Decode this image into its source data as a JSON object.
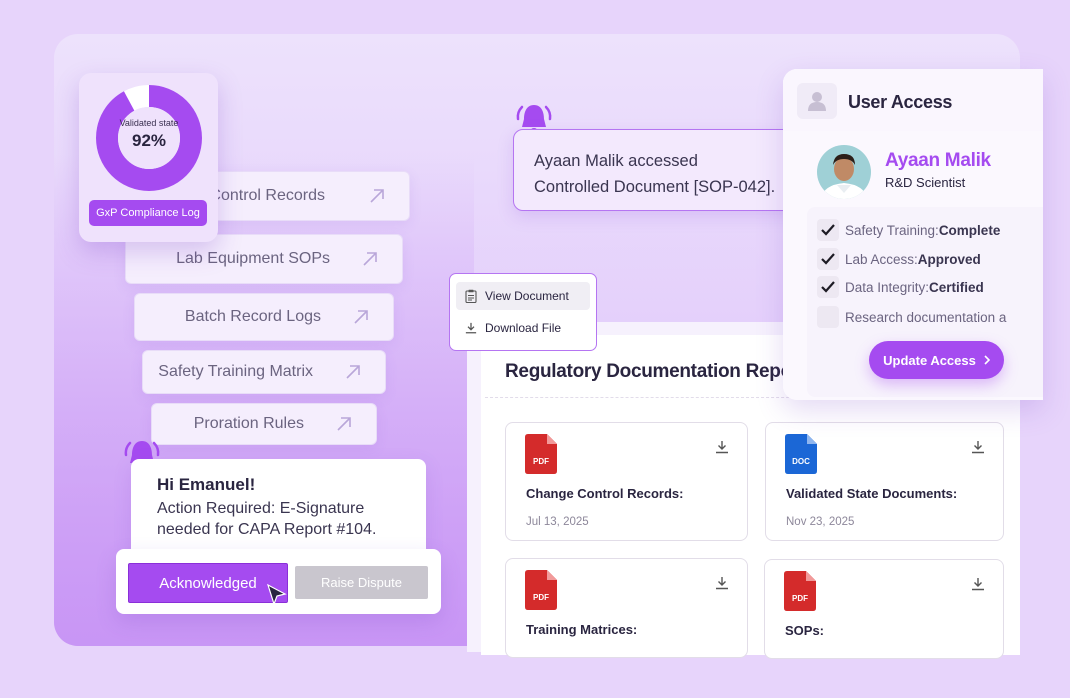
{
  "compliance": {
    "donut_label": "Validated state",
    "donut_value": "92%",
    "donut_fraction": 0.92,
    "log_button": "GxP Compliance Log"
  },
  "nav_items": [
    {
      "label": "e Control Records"
    },
    {
      "label": "Lab Equipment SOPs"
    },
    {
      "label": "Batch Record Logs"
    },
    {
      "label": "Safety Training Matrix"
    },
    {
      "label": "Proration Rules"
    }
  ],
  "notification": {
    "line1": "Ayaan Malik accessed",
    "line2": "Controlled Document [SOP-042]."
  },
  "context_menu": {
    "view": "View Document",
    "download": "Download File"
  },
  "report": {
    "title": "Regulatory Documentation Repo",
    "docs": [
      {
        "type": "PDF",
        "title": "Change Control Records:",
        "date": "Jul 13, 2025"
      },
      {
        "type": "DOC",
        "title": "Validated State Documents:",
        "date": "Nov 23, 2025"
      },
      {
        "type": "PDF",
        "title": "Training Matrices:",
        "date": ""
      },
      {
        "type": "PDF",
        "title": "SOPs:",
        "date": ""
      }
    ]
  },
  "user_access": {
    "title": "User Access",
    "name": "Ayaan Malik",
    "role": "R&D Scientist",
    "checks": [
      {
        "label": "Safety Training: ",
        "value": "Complete",
        "checked": true
      },
      {
        "label": "Lab Access: ",
        "value": "Approved",
        "checked": true
      },
      {
        "label": "Data Integrity: ",
        "value": "Certified",
        "checked": true
      },
      {
        "label": "Research documentation a",
        "value": "",
        "checked": false
      }
    ],
    "button": "Update Access"
  },
  "greeting": {
    "title": "Hi Emanuel!",
    "line1": "Action Required: E-Signature",
    "line2": "needed for CAPA Report #104."
  },
  "actions": {
    "acknowledge": "Acknowledged",
    "dispute": "Raise Dispute"
  },
  "colors": {
    "accent": "#a54bf0",
    "pdf": "#d42b2b",
    "doc": "#1b67d6"
  }
}
